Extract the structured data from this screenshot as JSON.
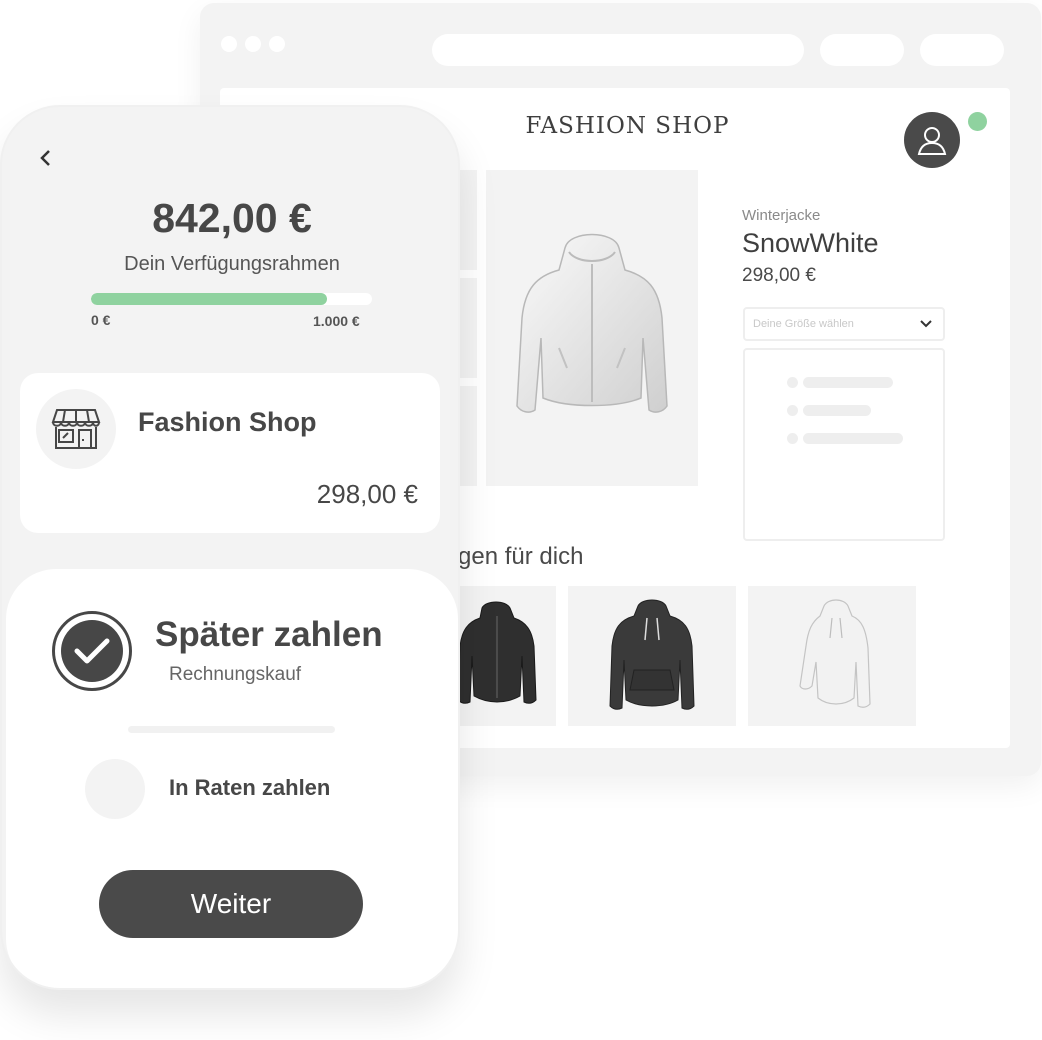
{
  "browser": {
    "shop_logo": "FASHION SHOP",
    "product": {
      "category": "Winterjacke",
      "name": "SnowWhite",
      "price": "298,00 €",
      "size_placeholder": "Deine Größe wählen"
    },
    "recommendations": {
      "title": "gen für dich"
    },
    "status_color": "#8fd29f"
  },
  "phone": {
    "available_amount": "842,00 €",
    "available_label": "Dein Verfügungsrahmen",
    "limit_progress": 0.84,
    "limit_min": "0 €",
    "limit_max": "1.000 €",
    "merchant": {
      "name": "Fashion Shop",
      "price": "298,00 €"
    },
    "payment": {
      "selected_title": "Später zahlen",
      "selected_subtitle": "Rechnungskauf",
      "alternative_title": "In Raten zahlen",
      "continue_label": "Weiter"
    },
    "accent_color": "#8fd29f",
    "dark_color": "#4a4a4a"
  }
}
